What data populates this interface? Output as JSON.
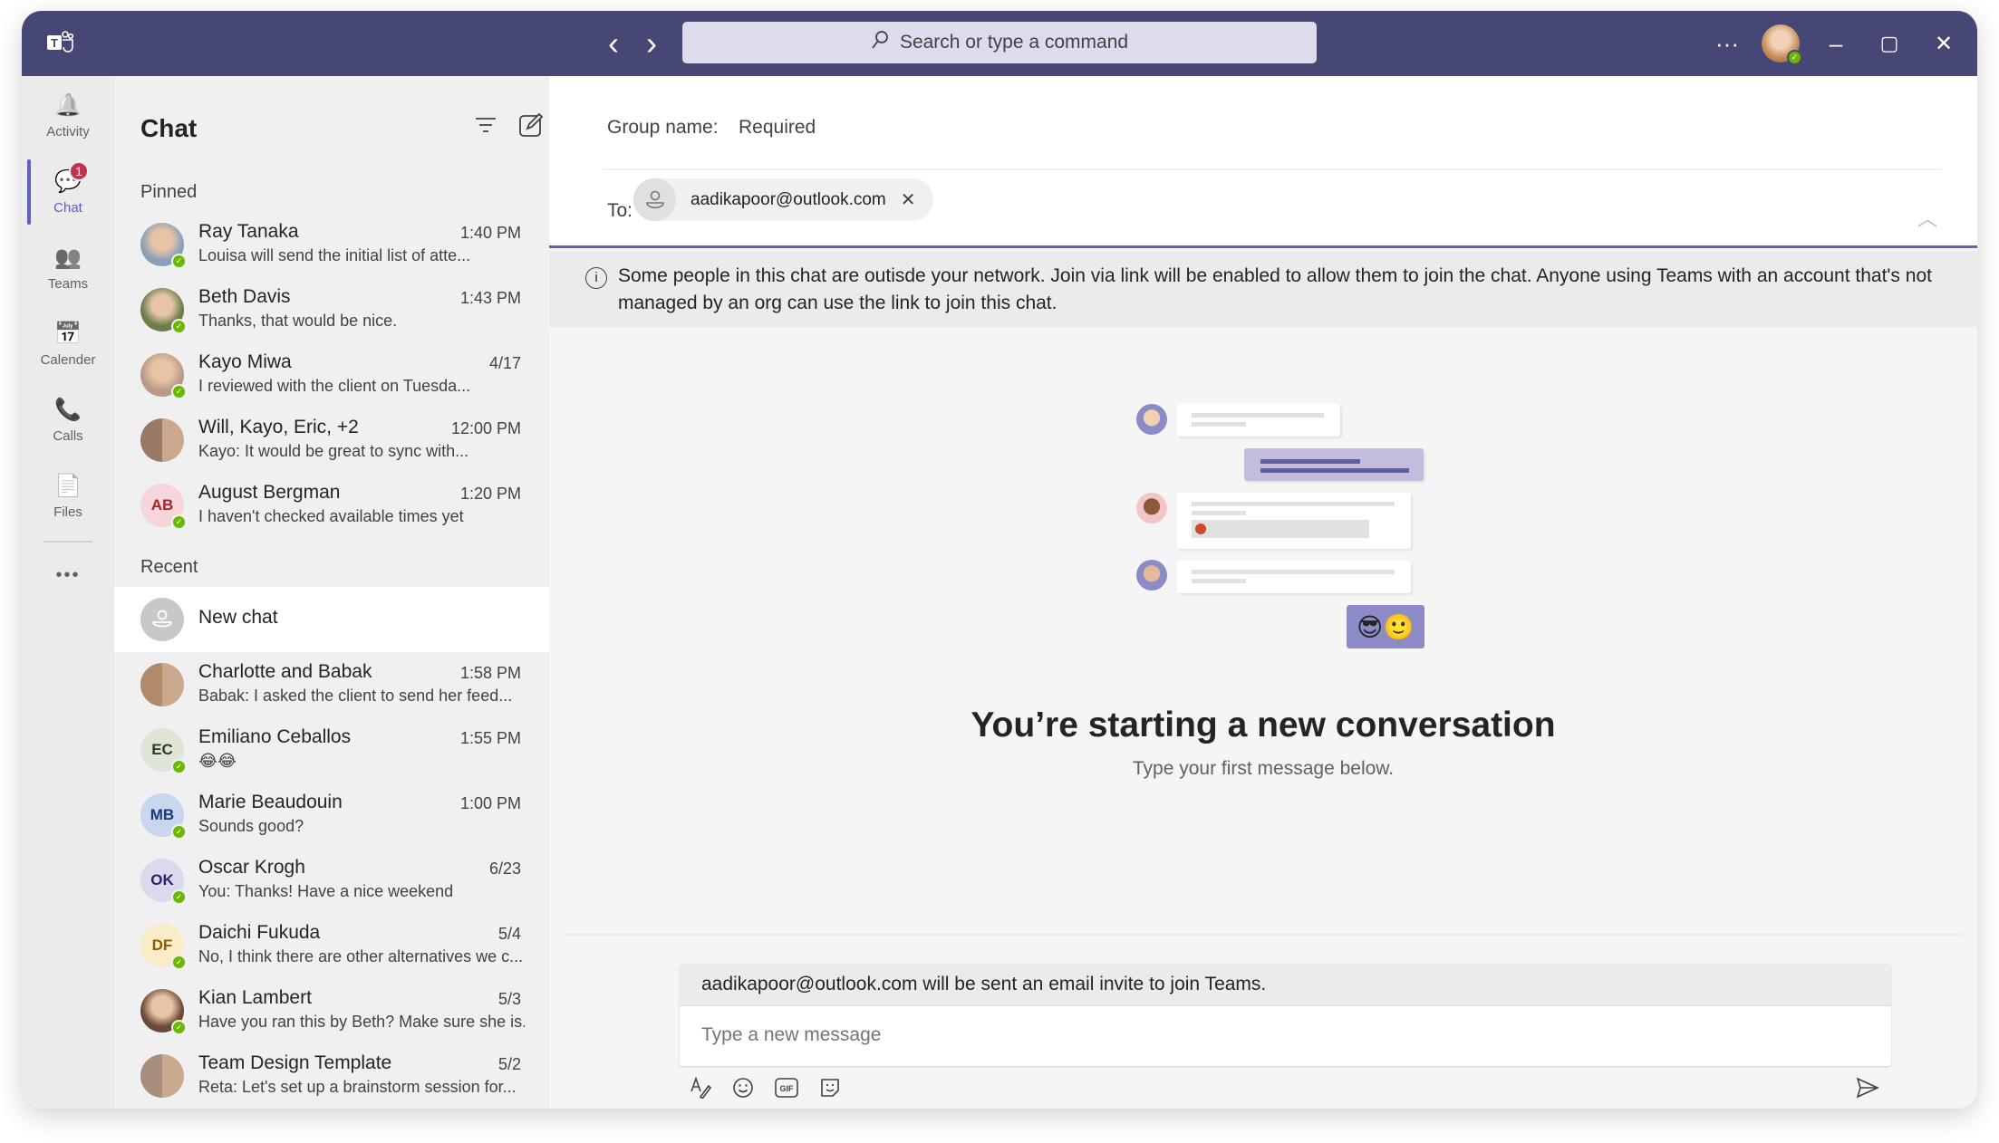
{
  "titlebar": {
    "search_placeholder": "Search or type a command",
    "back_icon": "‹",
    "forward_icon": "›",
    "more": "···",
    "minimize": "–",
    "maximize": "▢",
    "close": "✕"
  },
  "rail": {
    "items": [
      {
        "label": "Activity",
        "icon": "🔔"
      },
      {
        "label": "Chat",
        "icon": "💬",
        "badge": "1"
      },
      {
        "label": "Teams",
        "icon": "👥"
      },
      {
        "label": "Calender",
        "icon": "📅"
      },
      {
        "label": "Calls",
        "icon": "📞"
      },
      {
        "label": "Files",
        "icon": "📄"
      }
    ],
    "more": "•••"
  },
  "chatlist": {
    "title": "Chat",
    "pinned_label": "Pinned",
    "recent_label": "Recent",
    "pinned": [
      {
        "name": "Ray Tanaka",
        "time": "1:40 PM",
        "preview": "Louisa will send the initial list of atte...",
        "avatar_color": "#8aa0b8"
      },
      {
        "name": "Beth Davis",
        "time": "1:43 PM",
        "preview": "Thanks, that would be nice.",
        "avatar_color": "#6b7d4a"
      },
      {
        "name": "Kayo Miwa",
        "time": "4/17",
        "preview": "I reviewed with the client on Tuesda...",
        "avatar_color": "#b89a86"
      },
      {
        "name": "Will, Kayo, Eric, +2",
        "time": "12:00 PM",
        "preview": "Kayo: It would be great to sync with...",
        "avatar_color": "#9a7a64",
        "group": true
      },
      {
        "name": "August Bergman",
        "time": "1:20 PM",
        "preview": "I haven't checked available times yet",
        "initials": "AB",
        "avatar_color": "#f6d6da",
        "initials_color": "#a4262c"
      }
    ],
    "new_chat": "New chat",
    "recent": [
      {
        "name": "Charlotte and Babak",
        "time": "1:58 PM",
        "preview": "Babak: I asked the client to send her feed...",
        "avatar_color": "#b08a6a",
        "group": true
      },
      {
        "name": "Emiliano Ceballos",
        "time": "1:55 PM",
        "preview": "😂😂",
        "initials": "EC",
        "avatar_color": "#dfe6d8",
        "initials_color": "#2e3d20"
      },
      {
        "name": "Marie Beaudouin",
        "time": "1:00 PM",
        "preview": "Sounds good?",
        "initials": "MB",
        "avatar_color": "#c8d6ee",
        "initials_color": "#1b3a7a"
      },
      {
        "name": "Oscar Krogh",
        "time": "6/23",
        "preview": "You: Thanks! Have a nice weekend",
        "initials": "OK",
        "avatar_color": "#dcd8ee",
        "initials_color": "#2d1f6e"
      },
      {
        "name": "Daichi Fukuda",
        "time": "5/4",
        "preview": "No, I think there are other alternatives we c...",
        "initials": "DF",
        "avatar_color": "#faecc8",
        "initials_color": "#8a5d00"
      },
      {
        "name": "Kian Lambert",
        "time": "5/3",
        "preview": "Have you ran this by Beth? Make sure she is...",
        "avatar_color": "#6a4a36"
      },
      {
        "name": "Team Design Template",
        "time": "5/2",
        "preview": "Reta: Let's set up a brainstorm session for...",
        "avatar_color": "#a88e7c",
        "group": true
      }
    ]
  },
  "main": {
    "group_name_label": "Group name:",
    "group_name_placeholder": "Required",
    "to_label": "To:",
    "recipient": "aadikapoor@outlook.com",
    "info_text": "Some people in this chat are outisde your network. Join via link will be enabled to allow them to join the chat. Anyone using Teams with an account that's not managed by an org can use the link to join this chat.",
    "heading": "You’re starting a new conversation",
    "subheading": "Type your first message below.",
    "invite_notice": "aadikapoor@outlook.com will be sent an email invite to join Teams.",
    "message_placeholder": "Type a new message",
    "emoji_reaction": "😎🙂"
  },
  "colors": {
    "titlebar": "#464775",
    "accent": "#5b5fc7",
    "presence": "#6bb700",
    "badge": "#c4314b"
  }
}
